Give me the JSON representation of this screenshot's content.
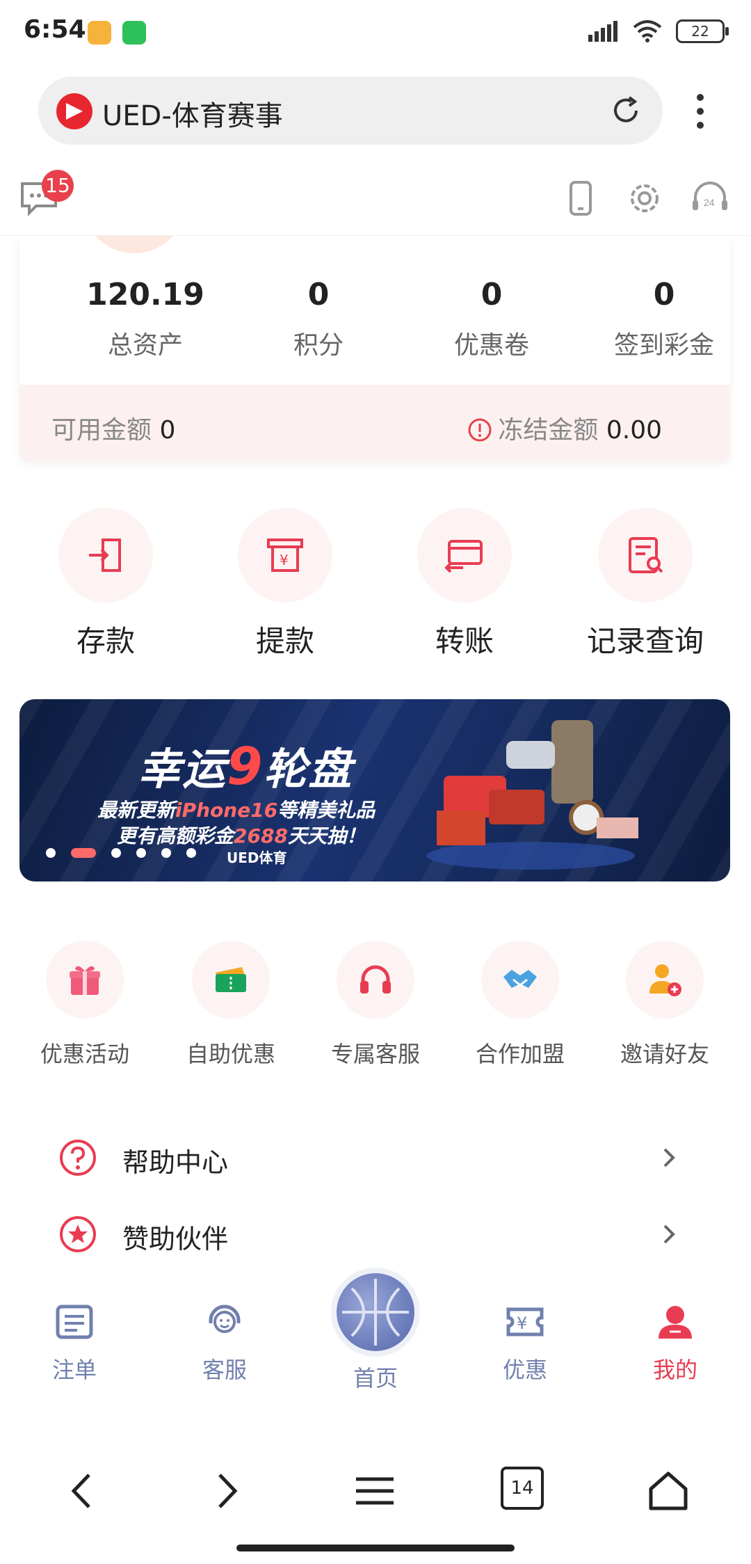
{
  "status": {
    "time": "6:54",
    "battery": "22"
  },
  "browser": {
    "title": "UED-体育赛事"
  },
  "header": {
    "message_badge": "15"
  },
  "assets": {
    "stats": [
      {
        "value": "120.19",
        "label": "总资产"
      },
      {
        "value": "0",
        "label": "积分"
      },
      {
        "value": "0",
        "label": "优惠卷"
      },
      {
        "value": "0",
        "label": "签到彩金"
      }
    ],
    "available_label": "可用金额",
    "available_value": "0",
    "frozen_label": "冻结金额",
    "frozen_value": "0.00"
  },
  "actions": [
    {
      "label": "存款",
      "icon": "deposit-icon"
    },
    {
      "label": "提款",
      "icon": "withdraw-icon"
    },
    {
      "label": "转账",
      "icon": "transfer-icon"
    },
    {
      "label": "记录查询",
      "icon": "records-icon"
    }
  ],
  "banner": {
    "title_part1": "幸运",
    "title_nine": "9",
    "title_part2": "轮盘",
    "line1_a": "最新更新",
    "line1_hl": "iPhone16",
    "line1_b": "等精美礼品",
    "line2_a": "更有高额彩金",
    "line2_hl": "2688",
    "line2_b": "天天抽！",
    "brand": "UED体育",
    "slides": 6,
    "active_slide": 2
  },
  "services": [
    {
      "label": "优惠活动",
      "icon": "gift-icon"
    },
    {
      "label": "自助优惠",
      "icon": "ticket-icon"
    },
    {
      "label": "专属客服",
      "icon": "headset-icon"
    },
    {
      "label": "合作加盟",
      "icon": "handshake-icon"
    },
    {
      "label": "邀请好友",
      "icon": "add-user-icon"
    }
  ],
  "menu": [
    {
      "label": "帮助中心",
      "icon": "help-icon"
    },
    {
      "label": "赞助伙伴",
      "icon": "star-icon"
    }
  ],
  "tabbar": [
    {
      "label": "注单"
    },
    {
      "label": "客服"
    },
    {
      "label": "首页"
    },
    {
      "label": "优惠"
    },
    {
      "label": "我的"
    }
  ],
  "navbar": {
    "tabs_count": "14"
  },
  "colors": {
    "accent": "#e83c52",
    "tab_inactive": "#7180ad",
    "banner_bg": "#152a5c"
  }
}
